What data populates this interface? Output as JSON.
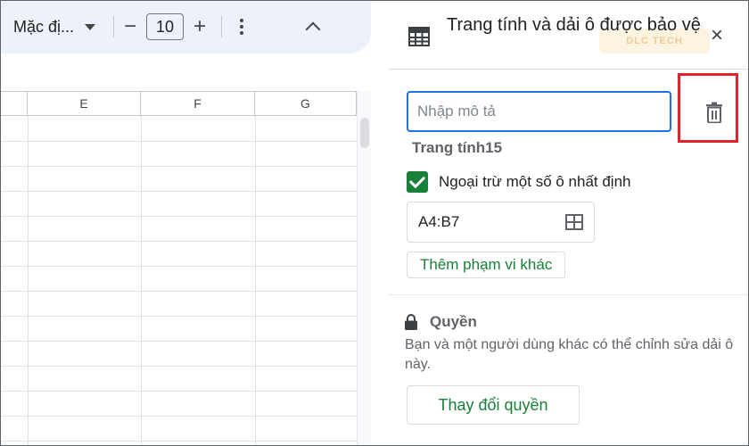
{
  "toolbar": {
    "font_name": "Mặc đị...",
    "minus_label": "−",
    "font_size": "10",
    "plus_label": "+"
  },
  "grid": {
    "columns": [
      "E",
      "F",
      "G"
    ]
  },
  "panel": {
    "title": "Trang tính và dải ô được bảo vệ",
    "close_label": "×",
    "watermark_text": "DLC TECH",
    "description": {
      "placeholder": "Nhập mô tả",
      "value": ""
    },
    "sheet_name": "Trang tính15",
    "except_checkbox": {
      "checked": true,
      "label": "Ngoại trừ một số ô nhất định"
    },
    "range_value": "A4:B7",
    "add_range_label": "Thêm phạm vi khác",
    "permissions": {
      "title": "Quyền",
      "description": "Bạn và một người dùng khác có thể chỉnh sửa dải ô này.",
      "change_label": "Thay đổi quyền"
    }
  },
  "colors": {
    "accent_blue": "#1a73e8",
    "accent_green": "#188038",
    "highlight_red": "#e0232a",
    "toolbar_bg": "#edf2fa"
  }
}
